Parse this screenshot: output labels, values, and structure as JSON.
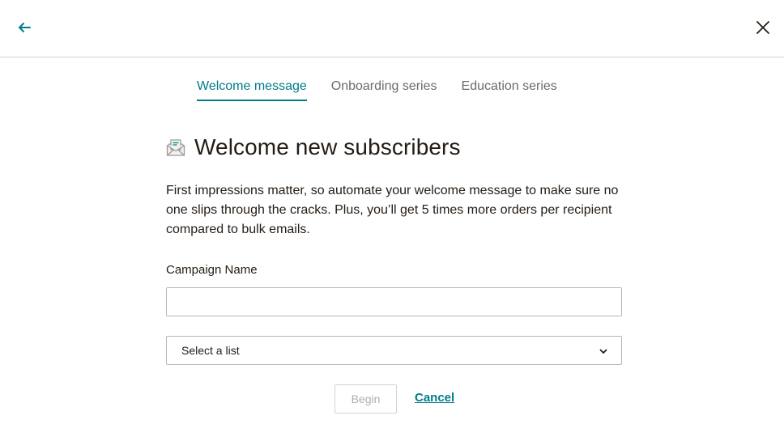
{
  "tabs": [
    {
      "label": "Welcome message",
      "active": true
    },
    {
      "label": "Onboarding series",
      "active": false
    },
    {
      "label": "Education series",
      "active": false
    }
  ],
  "header": {
    "back_icon": "arrow-left-icon",
    "close_icon": "close-icon"
  },
  "content": {
    "heading_icon": "envelope-open-icon",
    "heading": "Welcome new subscribers",
    "description": "First impressions matter, so automate your welcome message to make sure no one slips through the cracks. Plus, you’ll get 5 times more orders per recipient compared to bulk emails."
  },
  "form": {
    "campaign_name_label": "Campaign Name",
    "campaign_name_value": "",
    "list_select_value": "Select a list",
    "begin_label": "Begin",
    "cancel_label": "Cancel"
  },
  "colors": {
    "accent": "#007c89",
    "text": "#241c15",
    "muted_tab": "#6b6b6b",
    "disabled": "#b0aea9"
  }
}
